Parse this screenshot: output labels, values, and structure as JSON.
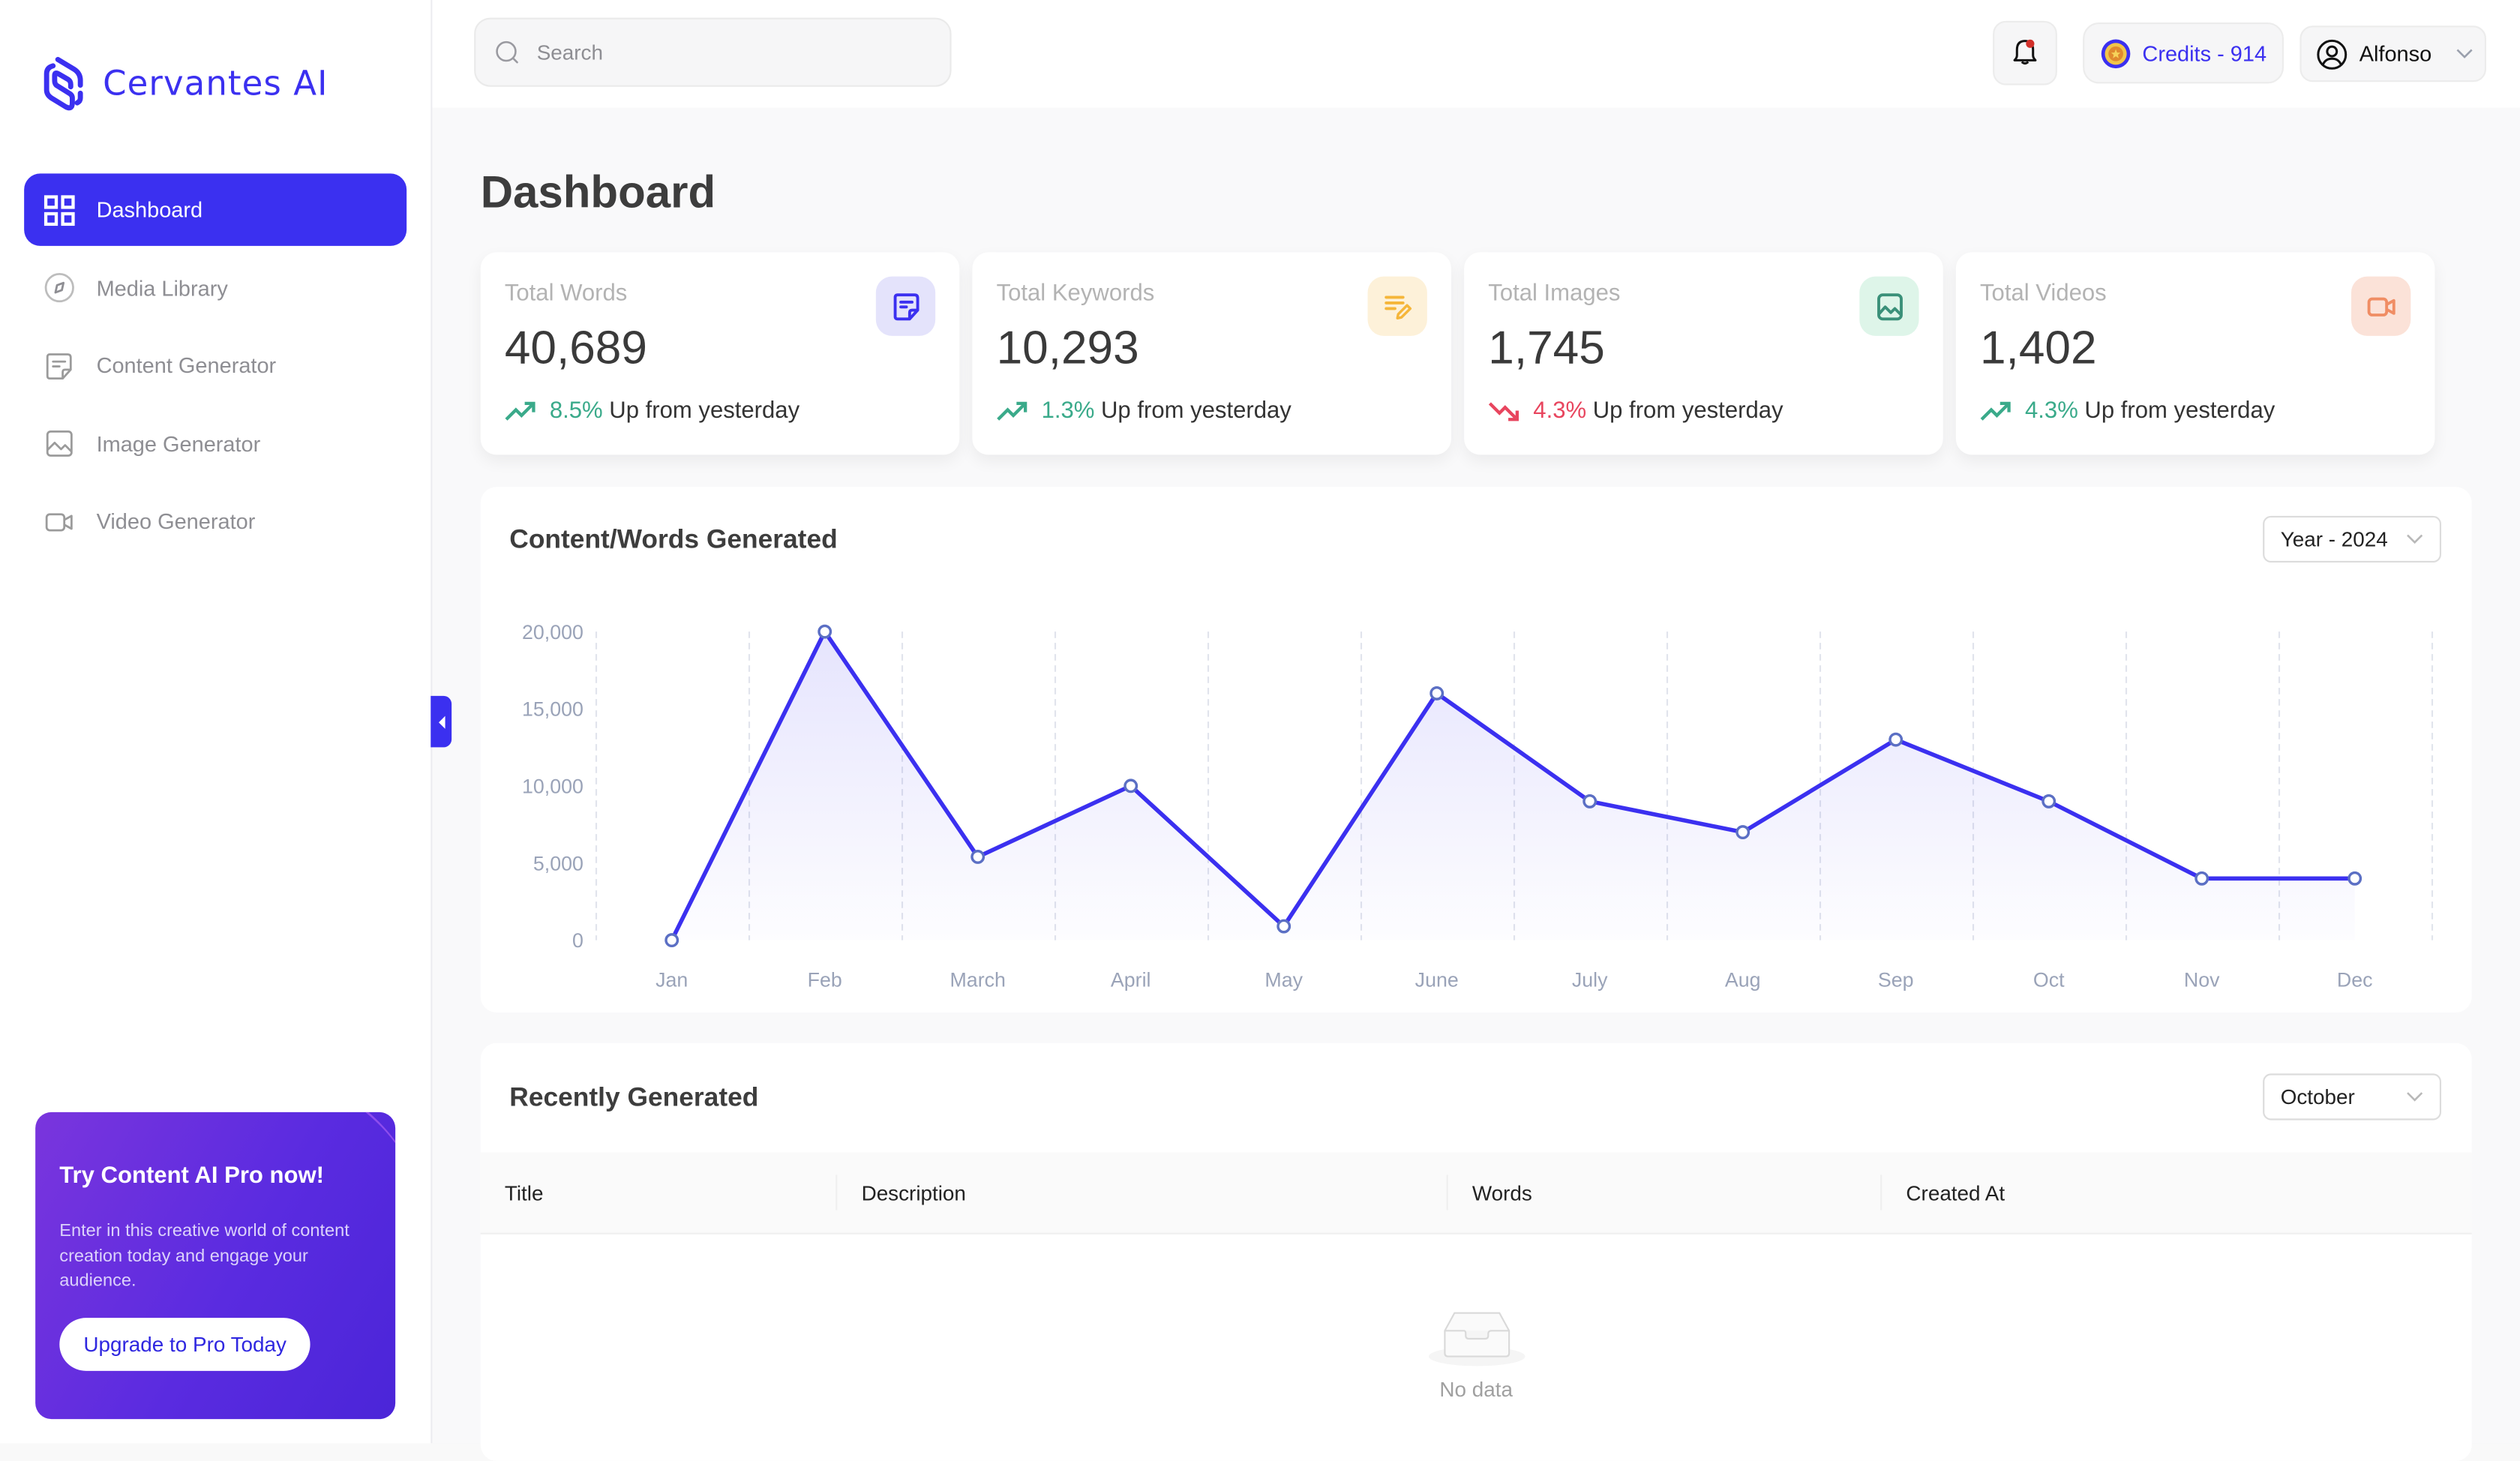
{
  "app": {
    "brand": "Cervantes AI",
    "brand_color": "#3b30f0"
  },
  "sidebar": {
    "items": [
      {
        "label": "Dashboard",
        "icon": "grid-icon",
        "active": true
      },
      {
        "label": "Media Library",
        "icon": "compass-icon",
        "active": false
      },
      {
        "label": "Content Generator",
        "icon": "note-icon",
        "active": false
      },
      {
        "label": "Image Generator",
        "icon": "image-icon",
        "active": false
      },
      {
        "label": "Video Generator",
        "icon": "video-icon",
        "active": false
      }
    ],
    "promo": {
      "title": "Try Content AI Pro now!",
      "text": "Enter in this creative world of content creation today and engage your audience.",
      "button": "Upgrade to Pro Today"
    }
  },
  "topbar": {
    "search_placeholder": "Search",
    "search_value": "",
    "credits_label": "Credits - 914",
    "user_name": "Alfonso",
    "notification_dot": true
  },
  "page": {
    "title": "Dashboard"
  },
  "stats": [
    {
      "label": "Total Words",
      "value": "40,689",
      "pct": "8.5%",
      "trend_text": "Up from yesterday",
      "direction": "up",
      "pct_color": "#3aaa8a",
      "icon": "note-icon",
      "icon_color": "#3b30f0",
      "icon_bg": "#e4e3fb"
    },
    {
      "label": "Total Keywords",
      "value": "10,293",
      "pct": "1.3%",
      "trend_text": "Up from yesterday",
      "direction": "up",
      "pct_color": "#3aaa8a",
      "icon": "edit-lines-icon",
      "icon_color": "#f5b63a",
      "icon_bg": "#fdf1d9"
    },
    {
      "label": "Total Images",
      "value": "1,745",
      "pct": "4.3%",
      "trend_text": "Up from yesterday",
      "direction": "down",
      "pct_color": "#e8455e",
      "icon": "image-icon",
      "icon_color": "#3a9079",
      "icon_bg": "#def5e9"
    },
    {
      "label": "Total Videos",
      "value": "1,402",
      "pct": "4.3%",
      "trend_text": "Up from yesterday",
      "direction": "up",
      "pct_color": "#3aaa8a",
      "icon": "video-icon",
      "icon_color": "#f08d64",
      "icon_bg": "#fbe2d8"
    }
  ],
  "chart_section": {
    "title": "Content/Words Generated",
    "period": "Year - 2024"
  },
  "chart_data": {
    "type": "area",
    "title": "Content/Words Generated",
    "categories": [
      "Jan",
      "Feb",
      "March",
      "April",
      "May",
      "June",
      "July",
      "Aug",
      "Sep",
      "Oct",
      "Nov",
      "Dec"
    ],
    "series": [
      {
        "name": "Words",
        "values": [
          0,
          20000,
          5400,
          10000,
          900,
          16000,
          9000,
          7000,
          13000,
          9000,
          4000,
          4000
        ],
        "color": "#3b30f0"
      }
    ],
    "yticks": [
      "0",
      "5,000",
      "10,000",
      "15,000",
      "20,000"
    ],
    "ylim": [
      0,
      20000
    ],
    "xlabel": "",
    "ylabel": "",
    "grid": "vertical-dashed",
    "legend": "none"
  },
  "recent": {
    "title": "Recently Generated",
    "month": "October",
    "columns": [
      "Title",
      "Description",
      "Words",
      "Created At"
    ],
    "rows": [],
    "empty_text": "No data"
  }
}
